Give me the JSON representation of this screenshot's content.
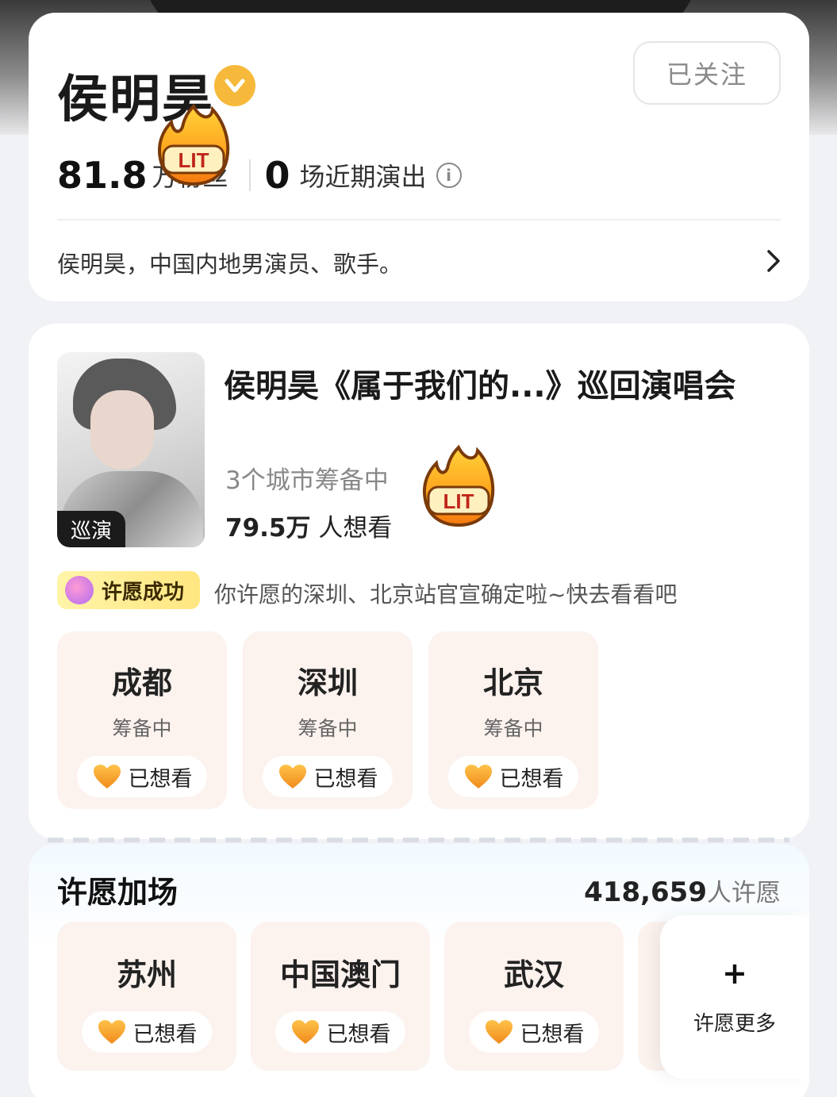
{
  "artist": {
    "name": "侯明昊",
    "follow_label": "已关注",
    "fans_value": "81.8",
    "fans_label": "万粉丝",
    "shows_value": "0",
    "shows_label": "场近期演出",
    "info_icon": "i",
    "bio": "侯明昊，中国内地男演员、歌手。"
  },
  "tour": {
    "tag": "巡演",
    "title": "侯明昊《属于我们的...》巡回演唱会",
    "cities_status": "3个城市筹备中",
    "wants_value": "79.5万",
    "wants_label": " 人想看",
    "wish_badge": "许愿成功",
    "wish_message": "你许愿的深圳、北京站官宣确定啦~快去看看吧",
    "cities": [
      {
        "name": "成都",
        "status": "筹备中",
        "action": "已想看"
      },
      {
        "name": "深圳",
        "status": "筹备中",
        "action": "已想看"
      },
      {
        "name": "北京",
        "status": "筹备中",
        "action": "已想看"
      }
    ]
  },
  "wish_section": {
    "title": "许愿加场",
    "count_value": "418,659",
    "count_label": "人许愿",
    "cities": [
      {
        "name": "苏州",
        "action": "已想看"
      },
      {
        "name": "中国澳门",
        "action": "已想看"
      },
      {
        "name": "武汉",
        "action": "已想看"
      }
    ],
    "more_icon": "+",
    "more_label": "许愿更多"
  },
  "stickers": [
    "LIT",
    "LIT"
  ],
  "colors": {
    "accent_orange": "#f6a623",
    "city_card_bg": "#fcf2ee",
    "verified_badge": "#f6b93b"
  }
}
